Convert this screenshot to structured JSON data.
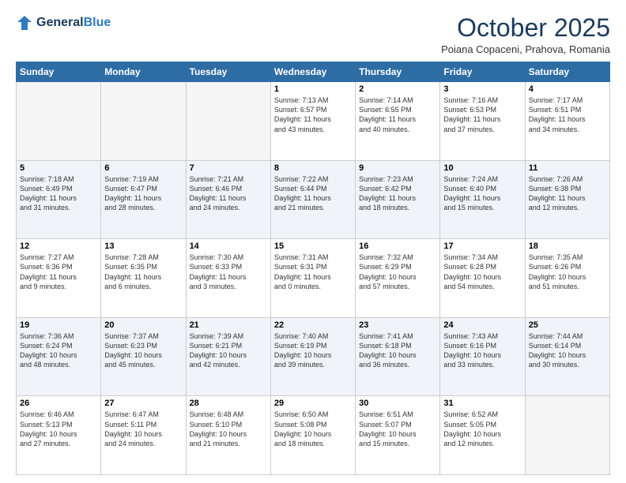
{
  "header": {
    "logo_line1": "General",
    "logo_line2": "Blue",
    "month": "October 2025",
    "location": "Poiana Copaceni, Prahova, Romania"
  },
  "weekdays": [
    "Sunday",
    "Monday",
    "Tuesday",
    "Wednesday",
    "Thursday",
    "Friday",
    "Saturday"
  ],
  "weeks": [
    [
      {
        "day": "",
        "info": ""
      },
      {
        "day": "",
        "info": ""
      },
      {
        "day": "",
        "info": ""
      },
      {
        "day": "1",
        "info": "Sunrise: 7:13 AM\nSunset: 6:57 PM\nDaylight: 11 hours\nand 43 minutes."
      },
      {
        "day": "2",
        "info": "Sunrise: 7:14 AM\nSunset: 6:55 PM\nDaylight: 11 hours\nand 40 minutes."
      },
      {
        "day": "3",
        "info": "Sunrise: 7:16 AM\nSunset: 6:53 PM\nDaylight: 11 hours\nand 37 minutes."
      },
      {
        "day": "4",
        "info": "Sunrise: 7:17 AM\nSunset: 6:51 PM\nDaylight: 11 hours\nand 34 minutes."
      }
    ],
    [
      {
        "day": "5",
        "info": "Sunrise: 7:18 AM\nSunset: 6:49 PM\nDaylight: 11 hours\nand 31 minutes."
      },
      {
        "day": "6",
        "info": "Sunrise: 7:19 AM\nSunset: 6:47 PM\nDaylight: 11 hours\nand 28 minutes."
      },
      {
        "day": "7",
        "info": "Sunrise: 7:21 AM\nSunset: 6:46 PM\nDaylight: 11 hours\nand 24 minutes."
      },
      {
        "day": "8",
        "info": "Sunrise: 7:22 AM\nSunset: 6:44 PM\nDaylight: 11 hours\nand 21 minutes."
      },
      {
        "day": "9",
        "info": "Sunrise: 7:23 AM\nSunset: 6:42 PM\nDaylight: 11 hours\nand 18 minutes."
      },
      {
        "day": "10",
        "info": "Sunrise: 7:24 AM\nSunset: 6:40 PM\nDaylight: 11 hours\nand 15 minutes."
      },
      {
        "day": "11",
        "info": "Sunrise: 7:26 AM\nSunset: 6:38 PM\nDaylight: 11 hours\nand 12 minutes."
      }
    ],
    [
      {
        "day": "12",
        "info": "Sunrise: 7:27 AM\nSunset: 6:36 PM\nDaylight: 11 hours\nand 9 minutes."
      },
      {
        "day": "13",
        "info": "Sunrise: 7:28 AM\nSunset: 6:35 PM\nDaylight: 11 hours\nand 6 minutes."
      },
      {
        "day": "14",
        "info": "Sunrise: 7:30 AM\nSunset: 6:33 PM\nDaylight: 11 hours\nand 3 minutes."
      },
      {
        "day": "15",
        "info": "Sunrise: 7:31 AM\nSunset: 6:31 PM\nDaylight: 11 hours\nand 0 minutes."
      },
      {
        "day": "16",
        "info": "Sunrise: 7:32 AM\nSunset: 6:29 PM\nDaylight: 10 hours\nand 57 minutes."
      },
      {
        "day": "17",
        "info": "Sunrise: 7:34 AM\nSunset: 6:28 PM\nDaylight: 10 hours\nand 54 minutes."
      },
      {
        "day": "18",
        "info": "Sunrise: 7:35 AM\nSunset: 6:26 PM\nDaylight: 10 hours\nand 51 minutes."
      }
    ],
    [
      {
        "day": "19",
        "info": "Sunrise: 7:36 AM\nSunset: 6:24 PM\nDaylight: 10 hours\nand 48 minutes."
      },
      {
        "day": "20",
        "info": "Sunrise: 7:37 AM\nSunset: 6:23 PM\nDaylight: 10 hours\nand 45 minutes."
      },
      {
        "day": "21",
        "info": "Sunrise: 7:39 AM\nSunset: 6:21 PM\nDaylight: 10 hours\nand 42 minutes."
      },
      {
        "day": "22",
        "info": "Sunrise: 7:40 AM\nSunset: 6:19 PM\nDaylight: 10 hours\nand 39 minutes."
      },
      {
        "day": "23",
        "info": "Sunrise: 7:41 AM\nSunset: 6:18 PM\nDaylight: 10 hours\nand 36 minutes."
      },
      {
        "day": "24",
        "info": "Sunrise: 7:43 AM\nSunset: 6:16 PM\nDaylight: 10 hours\nand 33 minutes."
      },
      {
        "day": "25",
        "info": "Sunrise: 7:44 AM\nSunset: 6:14 PM\nDaylight: 10 hours\nand 30 minutes."
      }
    ],
    [
      {
        "day": "26",
        "info": "Sunrise: 6:46 AM\nSunset: 5:13 PM\nDaylight: 10 hours\nand 27 minutes."
      },
      {
        "day": "27",
        "info": "Sunrise: 6:47 AM\nSunset: 5:11 PM\nDaylight: 10 hours\nand 24 minutes."
      },
      {
        "day": "28",
        "info": "Sunrise: 6:48 AM\nSunset: 5:10 PM\nDaylight: 10 hours\nand 21 minutes."
      },
      {
        "day": "29",
        "info": "Sunrise: 6:50 AM\nSunset: 5:08 PM\nDaylight: 10 hours\nand 18 minutes."
      },
      {
        "day": "30",
        "info": "Sunrise: 6:51 AM\nSunset: 5:07 PM\nDaylight: 10 hours\nand 15 minutes."
      },
      {
        "day": "31",
        "info": "Sunrise: 6:52 AM\nSunset: 5:05 PM\nDaylight: 10 hours\nand 12 minutes."
      },
      {
        "day": "",
        "info": ""
      }
    ]
  ]
}
